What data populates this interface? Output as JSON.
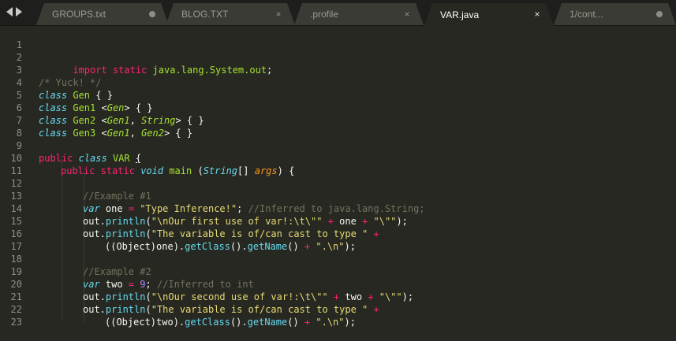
{
  "tabs": [
    {
      "label": "GROUPS.txt",
      "control": "dot"
    },
    {
      "label": "BLOG.TXT",
      "control": "×"
    },
    {
      "label": ".profile",
      "control": "×"
    },
    {
      "label": "VAR.java",
      "control": "×",
      "active": true
    },
    {
      "label": "1/cont...",
      "control": "dot"
    }
  ],
  "lines": [
    "1",
    "2",
    "3",
    "4",
    "5",
    "6",
    "7",
    "8",
    "9",
    "10",
    "11",
    "12",
    "13",
    "14",
    "15",
    "16",
    "17",
    "18",
    "19",
    "20",
    "21",
    "22",
    "23"
  ],
  "code": {
    "l1": [
      "import",
      " ",
      "static",
      " ",
      "java.lang.System.out",
      ";"
    ],
    "l3": "/* Yuck! */",
    "l4": [
      "class",
      " ",
      "Gen",
      " { }"
    ],
    "l5": [
      "class",
      " ",
      "Gen1",
      " <",
      "Gen",
      "> { }"
    ],
    "l6": [
      "class",
      " ",
      "Gen2",
      " <",
      "Gen1",
      ", ",
      "String",
      "> { }"
    ],
    "l7": [
      "class",
      " ",
      "Gen3",
      " <",
      "Gen1",
      ", ",
      "Gen2",
      "> { }"
    ],
    "l9": [
      "public",
      " ",
      "class",
      " ",
      "VAR",
      " ",
      "{"
    ],
    "l10": [
      "public",
      " ",
      "static",
      " ",
      "void",
      " ",
      "main",
      " (",
      "String",
      "[] ",
      "args",
      ") {"
    ],
    "l12": "//Example #1",
    "l13": [
      "var",
      " one ",
      "=",
      " ",
      "\"Type Inference!\"",
      "; ",
      "//Inferred to java.lang.String;"
    ],
    "l14": [
      "out.",
      "println",
      "(",
      "\"\\nOur first use of var!:\\t\\\"\"",
      " ",
      "+",
      " one ",
      "+",
      " ",
      "\"\\\"\"",
      ");"
    ],
    "l15": [
      "out.",
      "println",
      "(",
      "\"The variable is of/can cast to type \"",
      " ",
      "+"
    ],
    "l16": [
      "((Object)one).",
      "getClass",
      "().",
      "getName",
      "() ",
      "+",
      " ",
      "\".\\n\"",
      ");"
    ],
    "l18": "//Example #2",
    "l19": [
      "var",
      " two ",
      "=",
      " ",
      "9",
      "; ",
      "//Inferred to int"
    ],
    "l20": [
      "out.",
      "println",
      "(",
      "\"\\nOur second use of var!:\\t\\\"\"",
      " ",
      "+",
      " two ",
      "+",
      " ",
      "\"\\\"\"",
      ");"
    ],
    "l21": [
      "out.",
      "println",
      "(",
      "\"The variable is of/can cast to type \"",
      " ",
      "+"
    ],
    "l22": [
      "((Object)two).",
      "getClass",
      "().",
      "getName",
      "() ",
      "+",
      " ",
      "\".\\n\"",
      ");"
    ]
  }
}
